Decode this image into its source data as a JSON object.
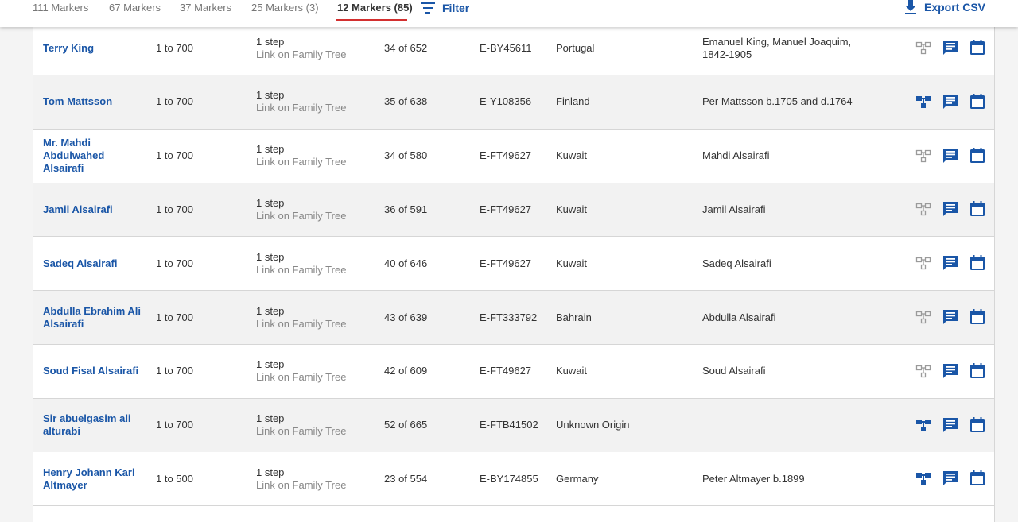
{
  "tabs": [
    {
      "label": "111 Markers"
    },
    {
      "label": "67 Markers"
    },
    {
      "label": "37 Markers"
    },
    {
      "label": "25 Markers (3)"
    },
    {
      "label": "12 Markers (85)",
      "active": true
    }
  ],
  "toolbar": {
    "filter_label": "Filter",
    "export_label": "Export CSV"
  },
  "colors": {
    "link": "#1a56a7",
    "active_tab_underline": "#d32f2f",
    "tree_active": "#1a56a7",
    "tree_inactive": "#9a9a9a"
  },
  "rows": [
    {
      "name": "Terry King",
      "range": "1 to 700",
      "steps": "1 step",
      "link": "Link on Family Tree",
      "cm": "34 of 652",
      "haplogroup": "E-BY45611",
      "country": "Portugal",
      "ancestor": "Emanuel King, Manuel Joaquim, 1842-1905",
      "tree_active": false
    },
    {
      "name": "Tom Mattsson",
      "range": "1 to 700",
      "steps": "1 step",
      "link": "Link on Family Tree",
      "cm": "35 of 638",
      "haplogroup": "E-Y108356",
      "country": "Finland",
      "ancestor": "Per Mattsson b.1705 and d.1764",
      "tree_active": true
    },
    {
      "name": "Mr. Mahdi Abdulwahed Alsairafi",
      "range": "1 to 700",
      "steps": "1 step",
      "link": "Link on Family Tree",
      "cm": "34 of 580",
      "haplogroup": "E-FT49627",
      "country": "Kuwait",
      "ancestor": "Mahdi Alsairafi",
      "tree_active": false
    },
    {
      "name": "Jamil Alsairafi",
      "range": "1 to 700",
      "steps": "1 step",
      "link": "Link on Family Tree",
      "cm": "36 of 591",
      "haplogroup": "E-FT49627",
      "country": "Kuwait",
      "ancestor": "Jamil Alsairafi",
      "tree_active": false
    },
    {
      "name": "Sadeq Alsairafi",
      "range": "1 to 700",
      "steps": "1 step",
      "link": "Link on Family Tree",
      "cm": "40 of 646",
      "haplogroup": "E-FT49627",
      "country": "Kuwait",
      "ancestor": "Sadeq Alsairafi",
      "tree_active": false
    },
    {
      "name": "Abdulla Ebrahim Ali Alsairafi",
      "range": "1 to 700",
      "steps": "1 step",
      "link": "Link on Family Tree",
      "cm": "43 of 639",
      "haplogroup": "E-FT333792",
      "country": "Bahrain",
      "ancestor": "Abdulla Alsairafi",
      "tree_active": false
    },
    {
      "name": "Soud Fisal Alsairafi",
      "range": "1 to 700",
      "steps": "1 step",
      "link": "Link on Family Tree",
      "cm": "42 of 609",
      "haplogroup": "E-FT49627",
      "country": "Kuwait",
      "ancestor": "Soud Alsairafi",
      "tree_active": false
    },
    {
      "name": "Sir abuelgasim ali alturabi",
      "range": "1 to 700",
      "steps": "1 step",
      "link": "Link on Family Tree",
      "cm": "52 of 665",
      "haplogroup": "E-FTB41502",
      "country": "Unknown Origin",
      "ancestor": "",
      "tree_active": true
    },
    {
      "name": "Henry Johann Karl Altmayer",
      "range": "1 to 500",
      "steps": "1 step",
      "link": "Link on Family Tree",
      "cm": "23 of 554",
      "haplogroup": "E-BY174855",
      "country": "Germany",
      "ancestor": "Peter Altmayer b.1899",
      "tree_active": true
    }
  ]
}
